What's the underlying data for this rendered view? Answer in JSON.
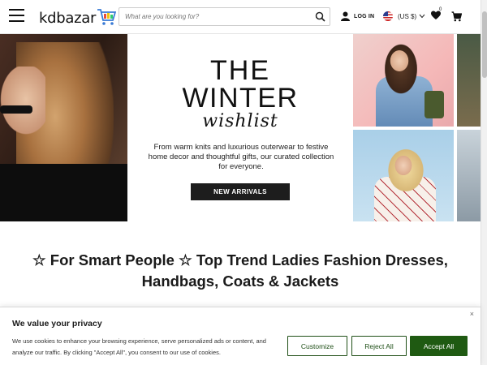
{
  "header": {
    "logo_text": "kdbazar",
    "search_placeholder": "What are you looking for?",
    "login_label": "LOG IN",
    "currency_label": "(US $)",
    "wishlist_count": "0"
  },
  "hero": {
    "title_line1": "THE",
    "title_line2": "WINTER",
    "title_script": "wishlist",
    "copy": "From warm knits and luxurious outerwear to festive home decor and thoughtful gifts, our curated collection for everyone.",
    "button_label": "NEW ARRIVALS"
  },
  "headline": {
    "line1": "☆ For Smart People ☆ Top Trend Ladies Fashion Dresses,",
    "line2": "Handbags, Coats & Jackets"
  },
  "cookie_banner": {
    "close_glyph": "×",
    "title": "We value your privacy",
    "text": "We use cookies to enhance your browsing experience, serve personalized ads or content, and analyze our traffic. By clicking \"Accept All\", you consent to our use of cookies.",
    "customize_label": "Customize",
    "reject_label": "Reject All",
    "accept_label": "Accept All"
  },
  "colors": {
    "accept_green": "#1f5a12",
    "button_dark": "#1d1d1d",
    "logo_cart_blue": "#3a7bd5"
  }
}
